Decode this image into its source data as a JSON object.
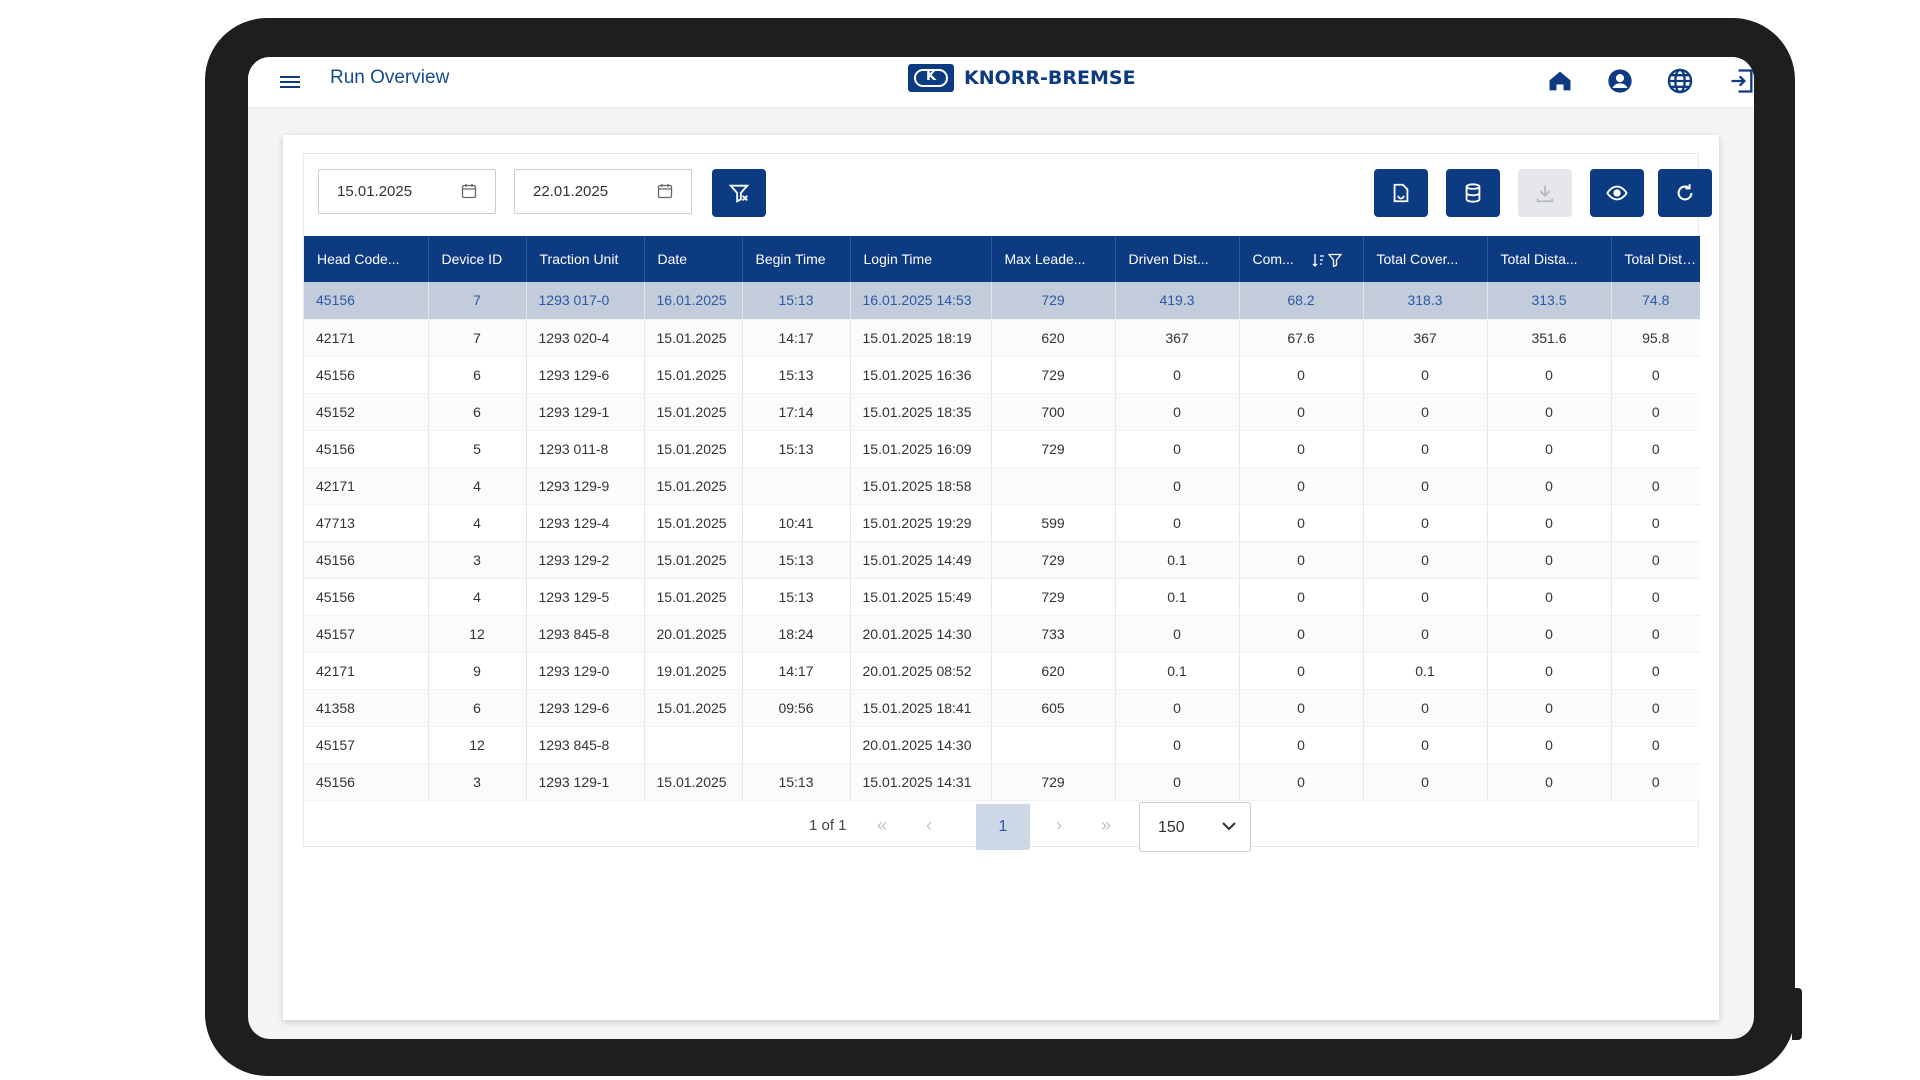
{
  "header": {
    "title": "Run Overview",
    "brand": "KNORR-BREMSE",
    "logo_mark": "K",
    "icons": [
      "home-icon",
      "account-icon",
      "globe-icon",
      "logout-icon"
    ]
  },
  "filters": {
    "date_from": "15.01.2025",
    "date_to": "22.01.2025"
  },
  "colors": {
    "primary": "#0d3b82",
    "selected_row": "#c3ccdb",
    "disabled": "#e6e7ea"
  },
  "table": {
    "columns": [
      "Head Code...",
      "Device ID",
      "Traction Unit",
      "Date",
      "Begin Time",
      "Login Time",
      "Max Leade...",
      "Driven Dist...",
      "Com...",
      "Total Cover...",
      "Total Dista...",
      "Total Dista..."
    ],
    "rows": [
      [
        "45156",
        "7",
        "1293 017-0",
        "16.01.2025",
        "15:13",
        "16.01.2025 14:53",
        "729",
        "419.3",
        "68.2",
        "318.3",
        "313.5",
        "74.8"
      ],
      [
        "42171",
        "7",
        "1293 020-4",
        "15.01.2025",
        "14:17",
        "15.01.2025 18:19",
        "620",
        "367",
        "67.6",
        "367",
        "351.6",
        "95.8"
      ],
      [
        "45156",
        "6",
        "1293 129-6",
        "15.01.2025",
        "15:13",
        "15.01.2025 16:36",
        "729",
        "0",
        "0",
        "0",
        "0",
        "0"
      ],
      [
        "45152",
        "6",
        "1293 129-1",
        "15.01.2025",
        "17:14",
        "15.01.2025 18:35",
        "700",
        "0",
        "0",
        "0",
        "0",
        "0"
      ],
      [
        "45156",
        "5",
        "1293 011-8",
        "15.01.2025",
        "15:13",
        "15.01.2025 16:09",
        "729",
        "0",
        "0",
        "0",
        "0",
        "0"
      ],
      [
        "42171",
        "4",
        "1293 129-9",
        "15.01.2025",
        "",
        "15.01.2025 18:58",
        "",
        "0",
        "0",
        "0",
        "0",
        "0"
      ],
      [
        "47713",
        "4",
        "1293 129-4",
        "15.01.2025",
        "10:41",
        "15.01.2025 19:29",
        "599",
        "0",
        "0",
        "0",
        "0",
        "0"
      ],
      [
        "45156",
        "3",
        "1293 129-2",
        "15.01.2025",
        "15:13",
        "15.01.2025 14:49",
        "729",
        "0.1",
        "0",
        "0",
        "0",
        "0"
      ],
      [
        "45156",
        "4",
        "1293 129-5",
        "15.01.2025",
        "15:13",
        "15.01.2025 15:49",
        "729",
        "0.1",
        "0",
        "0",
        "0",
        "0"
      ],
      [
        "45157",
        "12",
        "1293 845-8",
        "20.01.2025",
        "18:24",
        "20.01.2025 14:30",
        "733",
        "0",
        "0",
        "0",
        "0",
        "0"
      ],
      [
        "42171",
        "9",
        "1293 129-0",
        "19.01.2025",
        "14:17",
        "20.01.2025 08:52",
        "620",
        "0.1",
        "0",
        "0.1",
        "0",
        "0"
      ],
      [
        "41358",
        "6",
        "1293 129-6",
        "15.01.2025",
        "09:56",
        "15.01.2025 18:41",
        "605",
        "0",
        "0",
        "0",
        "0",
        "0"
      ],
      [
        "45157",
        "12",
        "1293 845-8",
        "",
        "",
        "20.01.2025 14:30",
        "",
        "0",
        "0",
        "0",
        "0",
        "0"
      ],
      [
        "45156",
        "3",
        "1293 129-1",
        "15.01.2025",
        "15:13",
        "15.01.2025 14:31",
        "729",
        "0",
        "0",
        "0",
        "0",
        "0"
      ]
    ],
    "selected_row": 0
  },
  "pagination": {
    "info": "1 of 1",
    "current_page": "1",
    "page_size": "150",
    "first": "«",
    "prev": "‹",
    "next": "›",
    "last": "»"
  }
}
